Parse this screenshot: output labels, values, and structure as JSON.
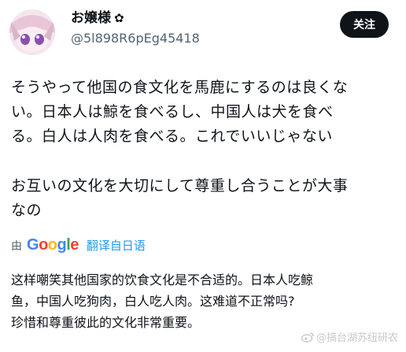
{
  "header": {
    "display_name": "お嬢様",
    "badge": "✿",
    "handle": "@5l898R6pEg45418",
    "follow_label": "关注"
  },
  "tweet": {
    "line1": "そうやって他国の食文化を馬鹿にするのは良くな",
    "line2": "い。日本人は鯨を食べるし、中国人は犬を食べ",
    "line3": "る。白人は人肉を食べる。これでいいじゃない",
    "line4": "お互いの文化を大切にして尊重し合うことが大事",
    "line5": "なの"
  },
  "translate": {
    "by_label": "由",
    "google_letters": [
      "G",
      "o",
      "o",
      "g",
      "l",
      "e"
    ],
    "link_label": "翻译自日语"
  },
  "translation": {
    "line1": "这样嘲笑其他国家的饮食文化是不合适的。日本人吃鲸",
    "line2": "鱼，中国人吃狗肉，白人吃人肉。这难道不正常吗?",
    "line3": "珍惜和尊重彼此的文化非常重要。"
  },
  "watermark": {
    "text": "@搞台湖苏纽研农"
  },
  "icons": [
    "avatar",
    "flower-badge-icon",
    "weibo-icon"
  ]
}
